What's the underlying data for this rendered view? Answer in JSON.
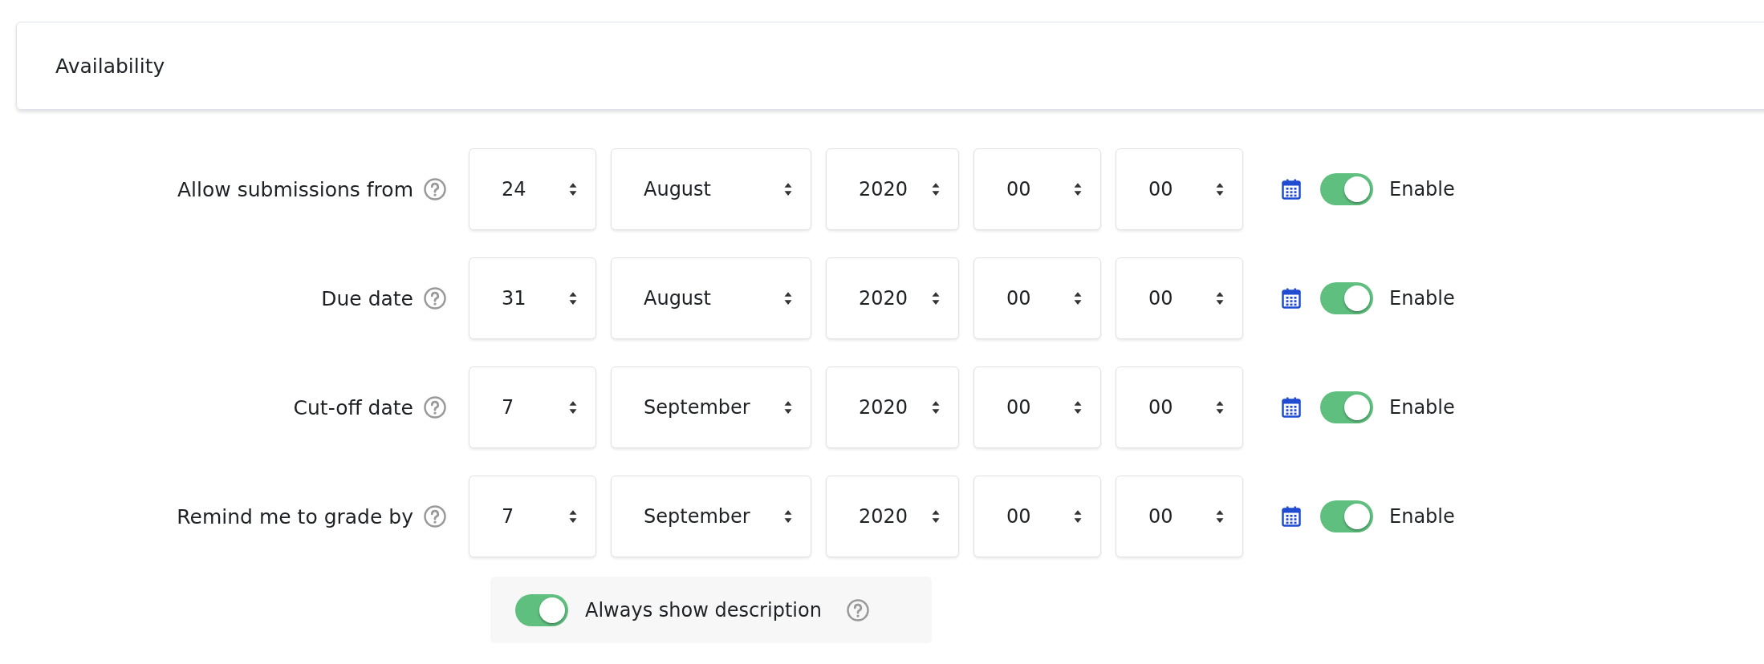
{
  "section": {
    "title": "Availability"
  },
  "rows": [
    {
      "label": "Allow submissions from",
      "day": "24",
      "month": "August",
      "year": "2020",
      "hour": "00",
      "minute": "00",
      "enable_label": "Enable",
      "enabled": true
    },
    {
      "label": "Due date",
      "day": "31",
      "month": "August",
      "year": "2020",
      "hour": "00",
      "minute": "00",
      "enable_label": "Enable",
      "enabled": true
    },
    {
      "label": "Cut-off date",
      "day": "7",
      "month": "September",
      "year": "2020",
      "hour": "00",
      "minute": "00",
      "enable_label": "Enable",
      "enabled": true
    },
    {
      "label": "Remind me to grade by",
      "day": "7",
      "month": "September",
      "year": "2020",
      "hour": "00",
      "minute": "00",
      "enable_label": "Enable",
      "enabled": true
    }
  ],
  "always_show_description": {
    "label": "Always show description",
    "on": true
  }
}
